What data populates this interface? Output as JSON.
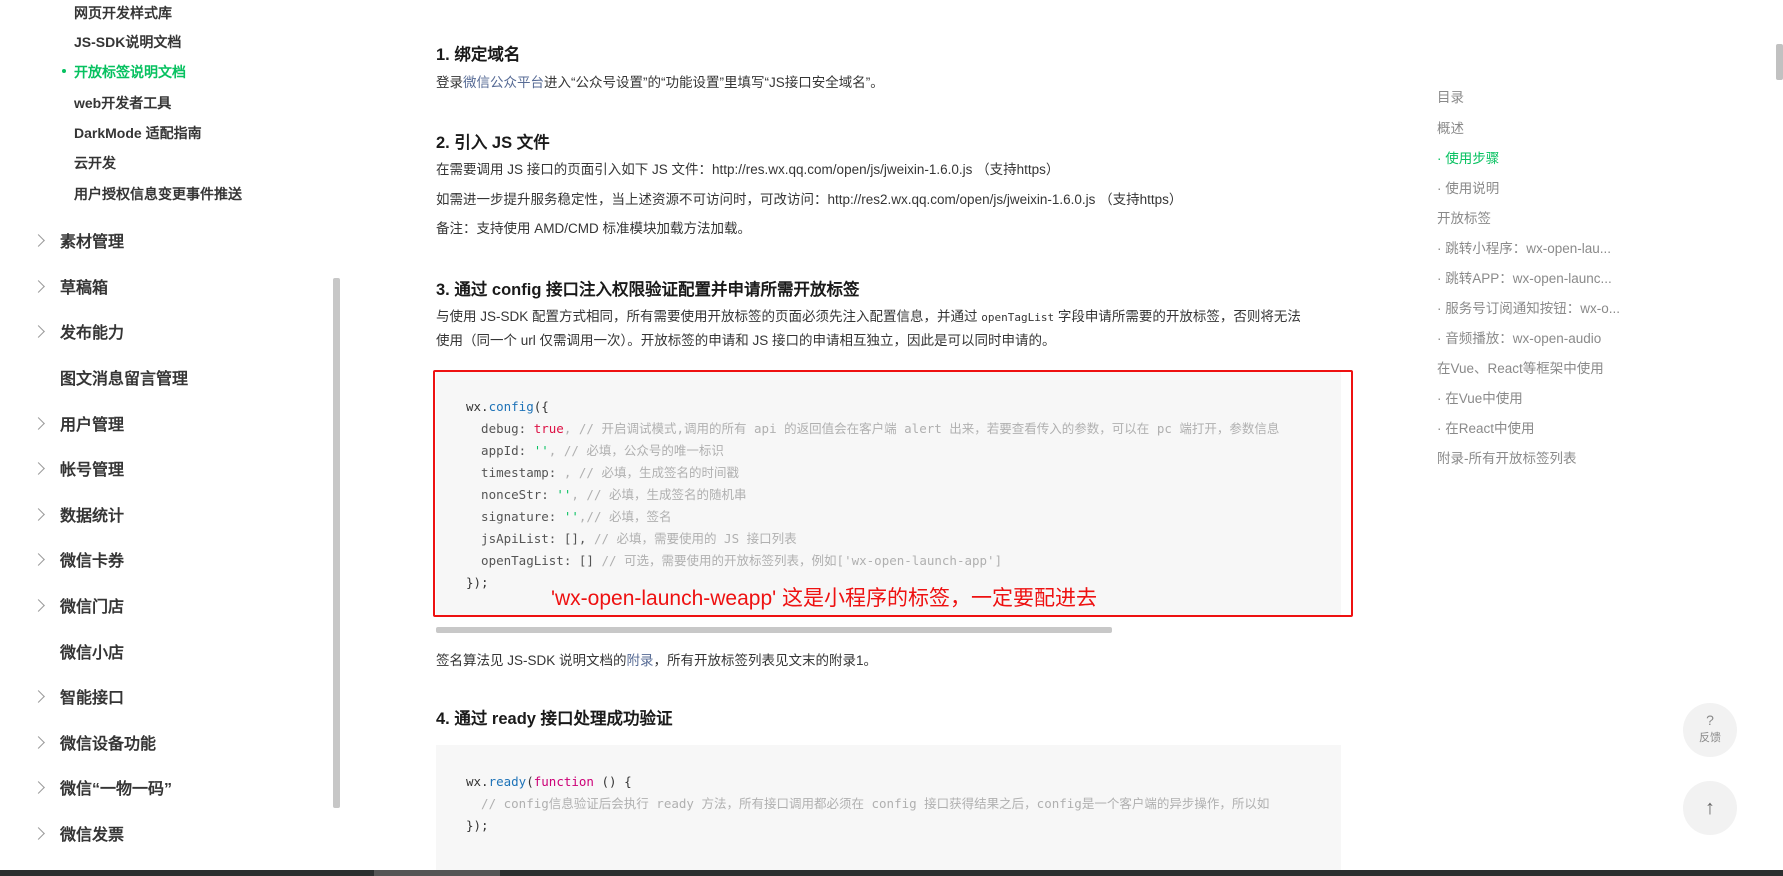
{
  "sidebar": {
    "sub_items": [
      "网页开发样式库",
      "JS-SDK说明文档",
      "开放标签说明文档",
      "web开发者工具",
      "DarkMode 适配指南",
      "云开发",
      "用户授权信息变更事件推送"
    ],
    "nav_items": [
      "素材管理",
      "草稿箱",
      "发布能力",
      "图文消息留言管理",
      "用户管理",
      "帐号管理",
      "数据统计",
      "微信卡券",
      "微信门店",
      "微信小店",
      "智能接口",
      "微信设备功能",
      "微信“一物一码”",
      "微信发票"
    ]
  },
  "content": {
    "s1_title": "1. 绑定域名",
    "s1_pre": "登录",
    "s1_link": "微信公众平台",
    "s1_post": "进入“公众号设置”的“功能设置”里填写“JS接口安全域名”。",
    "s2_title": "2. 引入 JS 文件",
    "s2_line1": "在需要调用 JS 接口的页面引入如下 JS 文件：http://res.wx.qq.com/open/js/jweixin-1.6.0.js （支持https）",
    "s2_line2": "如需进一步提升服务稳定性，当上述资源不可访问时，可改访问：http://res2.wx.qq.com/open/js/jweixin-1.6.0.js （支持https）",
    "s2_line3": "备注：支持使用 AMD/CMD 标准模块加载方法加载。",
    "s3_title": "3. 通过 config 接口注入权限验证配置并申请所需开放标签",
    "s3_line1_pre": "与使用 JS-SDK 配置方式相同，所有需要使用开放标签的页面必须先注入配置信息，并通过 ",
    "s3_line1_code": "openTagList",
    "s3_line1_post": " 字段申请所需要的开放标签，否则将无法",
    "s3_line2": "使用（同一个 url 仅需调用一次）。开放标签的申请和 JS 接口的申请相互独立，因此是可以同时申请的。",
    "code1": {
      "l1_obj": "wx.",
      "l1_fn": "config",
      "l1_end": "({",
      "l2_key": "  debug: ",
      "l2_val": "true",
      "l2_cmt": ", // 开启调试模式,调用的所有 api 的返回值会在客户端 alert 出来，若要查看传入的参数，可以在 pc 端打开，参数信息",
      "l3_key": "  appId: ",
      "l3_val": "''",
      "l3_cmt": ", // 必填，公众号的唯一标识",
      "l4_key": "  timestamp: ",
      "l4_cmt": ", // 必填，生成签名的时间戳",
      "l5_key": "  nonceStr: ",
      "l5_val": "''",
      "l5_cmt": ", // 必填，生成签名的随机串",
      "l6_key": "  signature: ",
      "l6_val": "''",
      "l6_cmt": ",// 必填，签名",
      "l7_key": "  jsApiList: [], ",
      "l7_cmt": "// 必填，需要使用的 JS 接口列表",
      "l8_key": "  openTagList: [] ",
      "l8_cmt": "// 可选，需要使用的开放标签列表，例如['wx-open-launch-app']",
      "l9": "});"
    },
    "annotation": "'wx-open-launch-weapp'  这是小程序的标签，一定要配进去",
    "s3_after_pre": "签名算法见 JS-SDK 说明文档的",
    "s3_after_link": "附录",
    "s3_after_post": "，所有开放标签列表见文末的附录1。",
    "s4_title": "4. 通过 ready 接口处理成功验证",
    "code2": {
      "l1_obj": "wx.",
      "l1_fn": "ready",
      "l1_open": "(",
      "l1_kw": "function",
      "l1_end": " () {",
      "l2_cmt": "  // config信息验证后会执行 ready 方法，所有接口调用都必须在 config 接口获得结果之后，config是一个客户端的异步操作，所以如",
      "l3": "});"
    }
  },
  "toc": {
    "items": [
      "目录",
      "概述",
      "· 使用步骤",
      "· 使用说明",
      "开放标签",
      "· 跳转小程序：wx-open-lau...",
      "· 跳转APP：wx-open-launc...",
      "· 服务号订阅通知按钮：wx-o...",
      "· 音频播放：wx-open-audio",
      "在Vue、React等框架中使用",
      "· 在Vue中使用",
      "· 在React中使用",
      "附录-所有开放标签列表"
    ]
  },
  "float": {
    "feedback_icon": "?",
    "feedback_label": "反馈",
    "top_icon": "↑"
  },
  "colors": {
    "accent": "#07c160",
    "link": "#576b95",
    "annotation": "#ee1111"
  }
}
